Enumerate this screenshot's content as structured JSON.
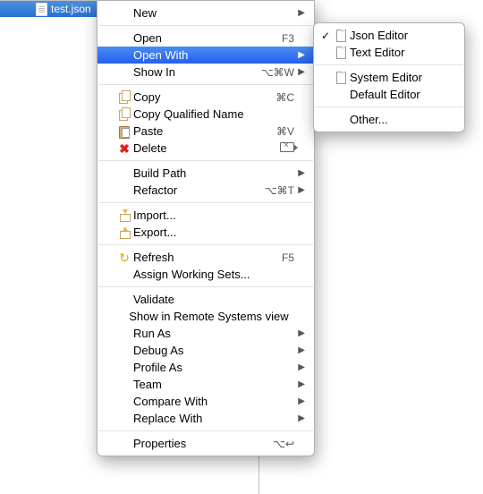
{
  "tree": {
    "selected_file": "test.json"
  },
  "context_menu": {
    "items": [
      {
        "label": "New",
        "submenu": true
      },
      "---",
      {
        "label": "Open",
        "shortcut": "F3"
      },
      {
        "label": "Open With",
        "submenu": true,
        "selected": true
      },
      {
        "label": "Show In",
        "shortcut": "⌥⌘W",
        "submenu": true
      },
      "---",
      {
        "label": "Copy",
        "shortcut": "⌘C",
        "icon": "copy"
      },
      {
        "label": "Copy Qualified Name",
        "icon": "copy"
      },
      {
        "label": "Paste",
        "shortcut": "⌘V",
        "icon": "paste"
      },
      {
        "label": "Delete",
        "shortcut": "delete-key",
        "icon": "delete"
      },
      "---",
      {
        "label": "Build Path",
        "submenu": true
      },
      {
        "label": "Refactor",
        "shortcut": "⌥⌘T",
        "submenu": true
      },
      "---",
      {
        "label": "Import...",
        "icon": "import"
      },
      {
        "label": "Export...",
        "icon": "export"
      },
      "---",
      {
        "label": "Refresh",
        "shortcut": "F5",
        "icon": "refresh"
      },
      {
        "label": "Assign Working Sets..."
      },
      "---",
      {
        "label": "Validate"
      },
      {
        "label": "Show in Remote Systems view"
      },
      {
        "label": "Run As",
        "submenu": true
      },
      {
        "label": "Debug As",
        "submenu": true
      },
      {
        "label": "Profile As",
        "submenu": true
      },
      {
        "label": "Team",
        "submenu": true
      },
      {
        "label": "Compare With",
        "submenu": true
      },
      {
        "label": "Replace With",
        "submenu": true
      },
      "---",
      {
        "label": "Properties",
        "shortcut": "⌥↩"
      }
    ]
  },
  "submenu": {
    "items": [
      {
        "label": "Json Editor",
        "icon": "file",
        "checked": true
      },
      {
        "label": "Text Editor",
        "icon": "file"
      },
      "---",
      {
        "label": "System Editor",
        "icon": "file"
      },
      {
        "label": "Default Editor"
      },
      "---",
      {
        "label": "Other..."
      }
    ]
  }
}
